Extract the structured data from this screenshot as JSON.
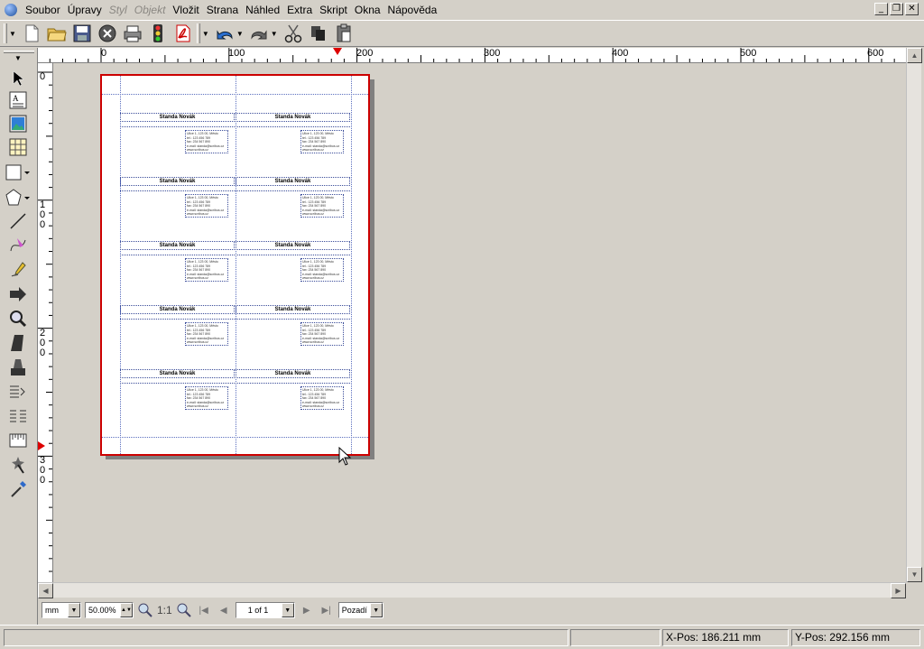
{
  "menubar": {
    "items": [
      {
        "label": "Soubor",
        "enabled": true
      },
      {
        "label": "Úpravy",
        "enabled": true
      },
      {
        "label": "Styl",
        "enabled": false
      },
      {
        "label": "Objekt",
        "enabled": false
      },
      {
        "label": "Vložit",
        "enabled": true
      },
      {
        "label": "Strana",
        "enabled": true
      },
      {
        "label": "Náhled",
        "enabled": true
      },
      {
        "label": "Extra",
        "enabled": true
      },
      {
        "label": "Skript",
        "enabled": true
      },
      {
        "label": "Okna",
        "enabled": true
      },
      {
        "label": "Nápověda",
        "enabled": true
      }
    ],
    "window_controls": {
      "minimize": "_",
      "restore": "❐",
      "close": "✕"
    }
  },
  "toolbar": {
    "icons": [
      "new-document-icon",
      "open-folder-icon",
      "save-icon",
      "close-document-icon",
      "print-icon",
      "preflight-icon",
      "pdf-export-icon",
      "undo-icon",
      "redo-icon",
      "cut-icon",
      "copy-icon",
      "paste-icon"
    ]
  },
  "tools": [
    "select-icon",
    "text-frame-icon",
    "image-frame-icon",
    "table-icon",
    "shape-icon",
    "polygon-icon",
    "line-icon",
    "bezier-icon",
    "freehand-icon",
    "rotate-icon",
    "zoom-icon",
    "edit-contents-icon",
    "edit-text-icon",
    "link-frames-icon",
    "unlink-frames-icon",
    "measure-icon",
    "copy-properties-icon",
    "eyedropper-icon"
  ],
  "rulers": {
    "horizontal_labels": [
      "0",
      "100",
      "200",
      "300",
      "400",
      "500",
      "600"
    ],
    "vertical_labels": [
      "0",
      "100",
      "200",
      "300"
    ]
  },
  "cards": {
    "name": "Standa Novák",
    "address": "Ulice 1, 123 00, Město\ntel.: 123 456 789\nfax: 234 567 890\ne-mail: standa@scribus.cz\nwww.scribus.cz"
  },
  "viewbar": {
    "unit": "mm",
    "zoom": "50.00%",
    "zoom_ratio": "1:1",
    "page": "1 of 1",
    "layer": "Pozadí"
  },
  "status": {
    "x_label": "X-Pos:",
    "x_value": "186.211 mm",
    "y_label": "Y-Pos:",
    "y_value": "292.156 mm"
  },
  "colors": {
    "chrome": "#d4d0c8",
    "page_border": "#cc0000",
    "guide": "#5b6fbf"
  }
}
